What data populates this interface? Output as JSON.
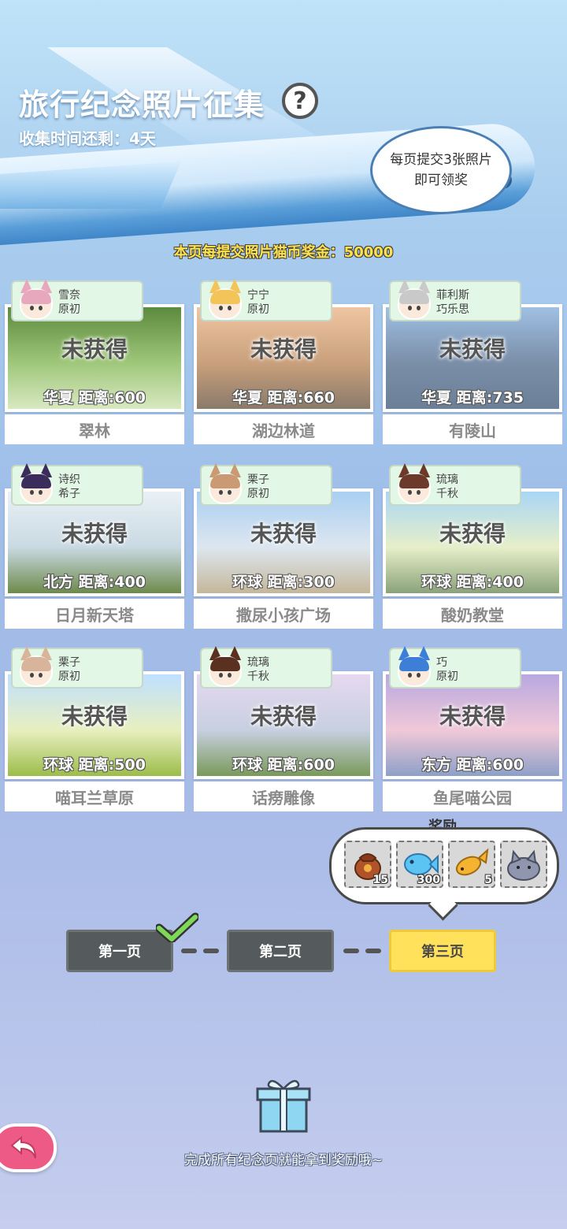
{
  "header": {
    "title": "旅行纪念照片征集",
    "help_symbol": "?",
    "timer": "收集时间还剩：4天",
    "bubble_line1": "每页提交3张照片",
    "bubble_line2": "即可领奖",
    "reward_banner": "本页每提交照片猫币奖金：50000"
  },
  "cards": [
    {
      "name1": "雪奈",
      "name2": "原初",
      "status": "未获得",
      "distance": "华夏 距离:600",
      "location": "翠林",
      "scene": [
        "#5c8a3e",
        "#9fc77a",
        "#d8e8c0"
      ]
    },
    {
      "name1": "宁宁",
      "name2": "原初",
      "status": "未获得",
      "distance": "华夏 距离:660",
      "location": "湖边林道",
      "scene": [
        "#f0c6a2",
        "#c9a07c",
        "#8a7a6a"
      ]
    },
    {
      "name1": "菲利斯",
      "name2": "巧乐思",
      "status": "未获得",
      "distance": "华夏 距离:735",
      "location": "有陵山",
      "scene": [
        "#9fc0e3",
        "#7a8ea8",
        "#6b7f98"
      ]
    },
    {
      "name1": "诗织",
      "name2": "希子",
      "status": "未获得",
      "distance": "北方 距离:400",
      "location": "日月新天塔",
      "scene": [
        "#e9f1f6",
        "#c9d9e2",
        "#6d8a4a"
      ]
    },
    {
      "name1": "栗子",
      "name2": "原初",
      "status": "未获得",
      "distance": "环球 距离:300",
      "location": "撒尿小孩广场",
      "scene": [
        "#a9cff2",
        "#dde6ef",
        "#c4b79a"
      ]
    },
    {
      "name1": "琉璃",
      "name2": "千秋",
      "status": "未获得",
      "distance": "环球 距离:400",
      "location": "酸奶教堂",
      "scene": [
        "#a9d6f5",
        "#e6efc9",
        "#8aa27a"
      ]
    },
    {
      "name1": "栗子",
      "name2": "原初",
      "status": "未获得",
      "distance": "环球 距离:500",
      "location": "喵耳兰草原",
      "scene": [
        "#bfe0ff",
        "#e8efbf",
        "#9cbd4a"
      ]
    },
    {
      "name1": "琉璃",
      "name2": "千秋",
      "status": "未获得",
      "distance": "环球 距离:600",
      "location": "话痨雕像",
      "scene": [
        "#e6d9f0",
        "#c7cfe0",
        "#7a9a5a"
      ]
    },
    {
      "name1": "巧",
      "name2": "原初",
      "status": "未获得",
      "distance": "东方 距离:600",
      "location": "鱼尾喵公园",
      "scene": [
        "#b8a8e0",
        "#f0c8d8",
        "#8da0c8"
      ]
    }
  ],
  "rewards": {
    "title": "奖励",
    "items": [
      {
        "icon": "treasure-bag-icon",
        "count": "15"
      },
      {
        "icon": "blue-fish-icon",
        "count": "300"
      },
      {
        "icon": "golden-fish-icon",
        "count": "5"
      },
      {
        "icon": "gray-cat-plush-icon",
        "count": ""
      }
    ]
  },
  "pages": [
    "第一页",
    "第二页",
    "第三页"
  ],
  "footer": {
    "message": "完成所有纪念页就能拿到奖励哦~"
  },
  "colors": {
    "active_page": "#ffe15c",
    "inactive_page": "#555a5d",
    "tag_bg": "#e3f7e6",
    "banner_text": "#ffe24a",
    "check": "#7ed957"
  }
}
